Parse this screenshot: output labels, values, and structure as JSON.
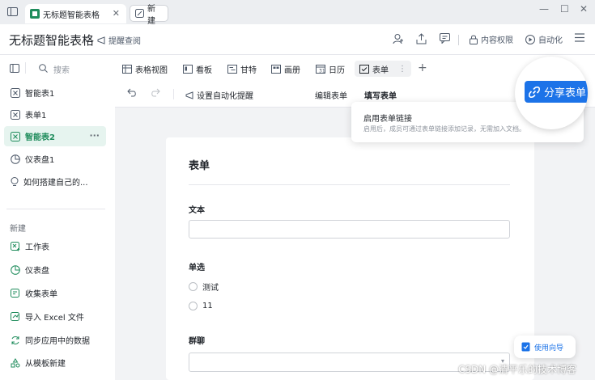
{
  "window": {
    "tabs": [
      {
        "label": "无标题智能表格"
      },
      {
        "label": "新建"
      }
    ]
  },
  "header": {
    "title": "无标题智能表格",
    "remind_label": "提醒查阅",
    "permission_label": "内容权限",
    "automation_label": "自动化"
  },
  "sidebar": {
    "search_placeholder": "搜索",
    "items": [
      {
        "label": "智能表1"
      },
      {
        "label": "表单1"
      },
      {
        "label": "智能表2"
      },
      {
        "label": "仪表盘1"
      },
      {
        "label": "如何搭建自己的..."
      }
    ],
    "new_section_label": "新建",
    "new_items": [
      {
        "label": "工作表"
      },
      {
        "label": "仪表盘"
      },
      {
        "label": "收集表单"
      },
      {
        "label": "导入 Excel 文件"
      },
      {
        "label": "同步应用中的数据"
      },
      {
        "label": "从模板新建"
      }
    ]
  },
  "view_tabs": [
    {
      "label": "表格视图"
    },
    {
      "label": "看板"
    },
    {
      "label": "甘特"
    },
    {
      "label": "画册"
    },
    {
      "label": "日历"
    },
    {
      "label": "表单"
    }
  ],
  "toolbar": {
    "auto_remind_label": "设置自动化提醒",
    "edit_form_label": "编辑表单",
    "fill_form_label": "填写表单"
  },
  "form": {
    "title": "表单",
    "fields": [
      {
        "label": "文本"
      },
      {
        "label": "单选",
        "options": [
          "测试",
          "11"
        ]
      },
      {
        "label": "群聊"
      }
    ]
  },
  "popover": {
    "title": "启用表单链接",
    "description": "启用后，成员可通过表单链接添加记录，无需加入文档。"
  },
  "share_button_label": "分享表单",
  "guide_label": "使用向导",
  "watermark": "CSDN @清平乐的技术博客",
  "colors": {
    "accent": "#1c73e8",
    "active_sheet": "#1f8c5c"
  }
}
